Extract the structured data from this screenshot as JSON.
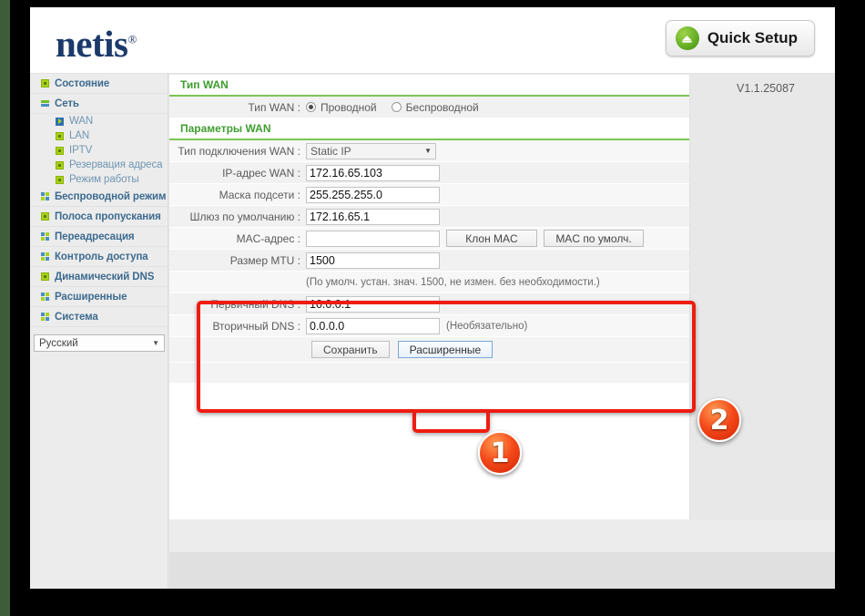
{
  "header": {
    "brand": "netis",
    "brand_reg": "®",
    "quick_setup_label": "Quick Setup",
    "quick_setup_icon": "refresh-circle-icon"
  },
  "version": "V1.1.25087",
  "sidebar": {
    "items": [
      {
        "label": "Состояние",
        "icon": "green-dot-icon",
        "level": "top"
      },
      {
        "label": "Сеть",
        "icon": "green-blue-bars-icon",
        "level": "top"
      },
      {
        "label": "WAN",
        "icon": "blue-play-icon",
        "level": "sub"
      },
      {
        "label": "LAN",
        "icon": "green-dot-icon",
        "level": "sub"
      },
      {
        "label": "IPTV",
        "icon": "green-dot-icon",
        "level": "sub"
      },
      {
        "label": "Резервация адреса",
        "icon": "green-dot-icon",
        "level": "sub"
      },
      {
        "label": "Режим работы",
        "icon": "green-dot-icon",
        "level": "sub"
      },
      {
        "label": "Беспроводной режим",
        "icon": "grid-squares-icon",
        "level": "top"
      },
      {
        "label": "Полоса пропускания",
        "icon": "green-dot-icon",
        "level": "top"
      },
      {
        "label": "Переадресация",
        "icon": "grid-squares-icon",
        "level": "top"
      },
      {
        "label": "Контроль доступа",
        "icon": "grid-squares-icon",
        "level": "top"
      },
      {
        "label": "Динамический DNS",
        "icon": "green-dot-icon",
        "level": "top"
      },
      {
        "label": "Расширенные",
        "icon": "grid-squares-icon",
        "level": "top"
      },
      {
        "label": "Система",
        "icon": "grid-squares-icon",
        "level": "top"
      }
    ],
    "language": {
      "value": "Русский",
      "caret": "▼"
    }
  },
  "content": {
    "wan_type_section": {
      "title": "Тип WAN",
      "row_label": "Тип WAN :",
      "options": [
        {
          "label": "Проводной",
          "checked": true
        },
        {
          "label": "Беспроводной",
          "checked": false
        }
      ]
    },
    "wan_params_section": {
      "title": "Параметры WAN",
      "rows": {
        "connection_type": {
          "label": "Тип подключения WAN :",
          "value": "Static IP",
          "caret": "▼"
        },
        "wan_ip": {
          "label": "IP-адрес WAN :",
          "value": "172.16.65.103"
        },
        "subnet_mask": {
          "label": "Маска подсети :",
          "value": "255.255.255.0"
        },
        "gateway": {
          "label": "Шлюз по умолчанию :",
          "value": "172.16.65.1"
        },
        "mac_address": {
          "label": "MAC-адрес :",
          "value": "",
          "clone_button": "Клон MAC",
          "default_button": "MAC по умолч."
        },
        "mtu": {
          "label": "Размер MTU :",
          "value": "1500",
          "hint": "(По умолч. устан. знач. 1500, не измен. без необходимости.)"
        },
        "primary_dns": {
          "label": "Первичный DNS :",
          "value": "10.0.0.1"
        },
        "secondary_dns": {
          "label": "Вторичный DNS :",
          "value": "0.0.0.0",
          "hint": "(Необязательно)"
        }
      },
      "actions": {
        "save_label": "Сохранить",
        "advanced_label": "Расширенные"
      }
    }
  },
  "annotations": {
    "callout_1": "1",
    "callout_2": "2",
    "highlight_color": "#ee1c11"
  }
}
